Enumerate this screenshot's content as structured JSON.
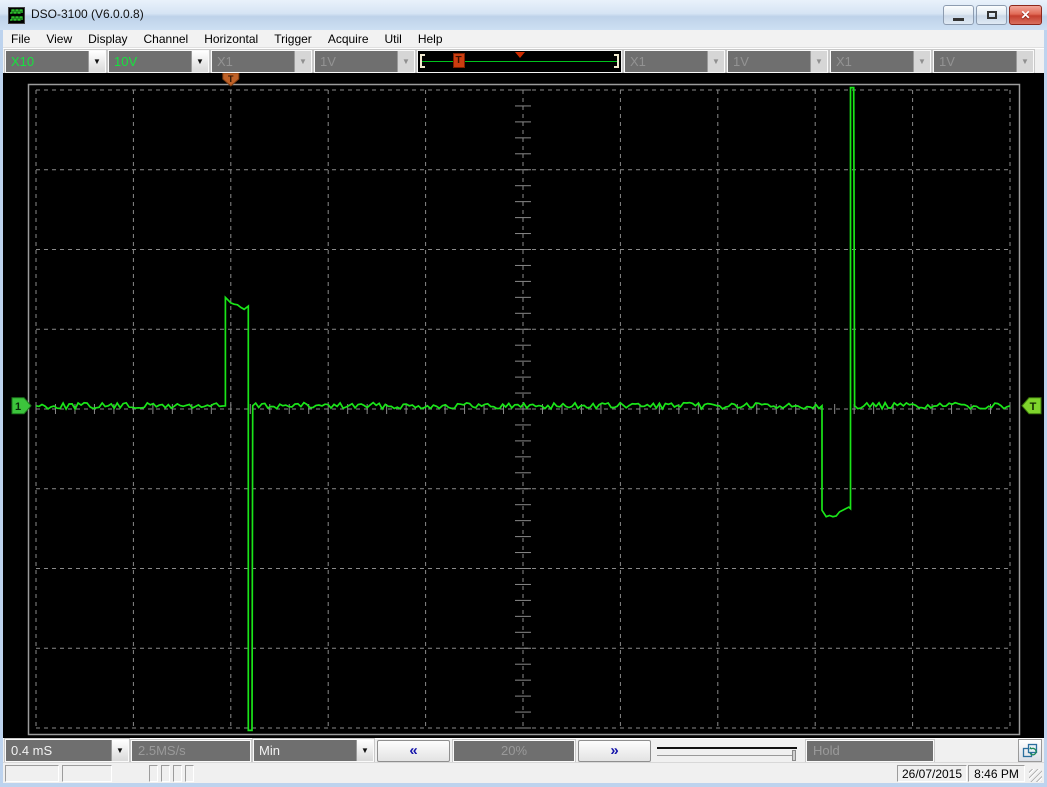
{
  "window": {
    "title": "DSO-3100 (V6.0.0.8)",
    "controls": {
      "minimize": "minimize",
      "maximize": "maximize",
      "close_glyph": "✕"
    }
  },
  "menu": {
    "items": [
      "File",
      "View",
      "Display",
      "Channel",
      "Horizontal",
      "Trigger",
      "Acquire",
      "Util",
      "Help"
    ]
  },
  "icons": {
    "dropdown_arrow": "▼",
    "scroll_left": "«",
    "scroll_right": "»"
  },
  "toolbar": {
    "combos": [
      {
        "value": "X10",
        "enabled": true
      },
      {
        "value": "10V",
        "enabled": true
      },
      {
        "value": "X1",
        "enabled": false
      },
      {
        "value": "1V",
        "enabled": false
      },
      {
        "value": "X1",
        "enabled": false
      },
      {
        "value": "1V",
        "enabled": false
      },
      {
        "value": "X1",
        "enabled": false
      },
      {
        "value": "1V",
        "enabled": false
      }
    ],
    "trigger_widget": {
      "marker": "T",
      "position_percent": 20
    }
  },
  "scope": {
    "channel_marker": "1",
    "trigger_level_marker": "T",
    "trigger_time_marker": "T",
    "accent_green": "#1ae519",
    "grid_color": "#8a8a8a"
  },
  "bottom_toolbar": {
    "timebase": "0.4 mS",
    "sample_rate": "2.5MS/s",
    "acquire_mode": "Min",
    "position_percent": "20%",
    "hold_label": "Hold"
  },
  "status_bar": {
    "date": "26/07/2015",
    "time": "8:46 PM"
  },
  "chart_data": {
    "type": "line",
    "title": "Oscilloscope channel 1 trace",
    "x_unit": "ms",
    "y_unit": "V",
    "time_per_div_ms": 0.4,
    "volts_per_div": 10,
    "xlim": [
      0,
      4
    ],
    "ylim": [
      -40,
      40
    ],
    "grid_divs": {
      "x": 10,
      "y": 8
    },
    "trigger": {
      "position_percent": 20,
      "level_v": 0
    },
    "baseline_noise_vpp": 0.8,
    "points": [
      {
        "t": 0.0,
        "v": 0.4,
        "noisy": true
      },
      {
        "t": 0.778,
        "v": 0.4
      },
      {
        "t": 0.778,
        "v": 14.0
      },
      {
        "t": 0.8,
        "v": 13.3,
        "noisy": true
      },
      {
        "t": 0.855,
        "v": 12.5
      },
      {
        "t": 0.872,
        "v": 12.9
      },
      {
        "t": 0.872,
        "v": -40.3
      },
      {
        "t": 0.887,
        "v": -40.3
      },
      {
        "t": 0.89,
        "v": 0.4,
        "noisy": true
      },
      {
        "t": 3.228,
        "v": 0.4
      },
      {
        "t": 3.228,
        "v": -12.7
      },
      {
        "t": 3.245,
        "v": -13.5,
        "noisy": true
      },
      {
        "t": 3.3,
        "v": -12.9
      },
      {
        "t": 3.338,
        "v": -12.3
      },
      {
        "t": 3.345,
        "v": -12.5
      },
      {
        "t": 3.345,
        "v": 40.3
      },
      {
        "t": 3.358,
        "v": 40.3
      },
      {
        "t": 3.362,
        "v": 0.4,
        "noisy": true
      },
      {
        "t": 4.0,
        "v": 0.4
      }
    ]
  }
}
